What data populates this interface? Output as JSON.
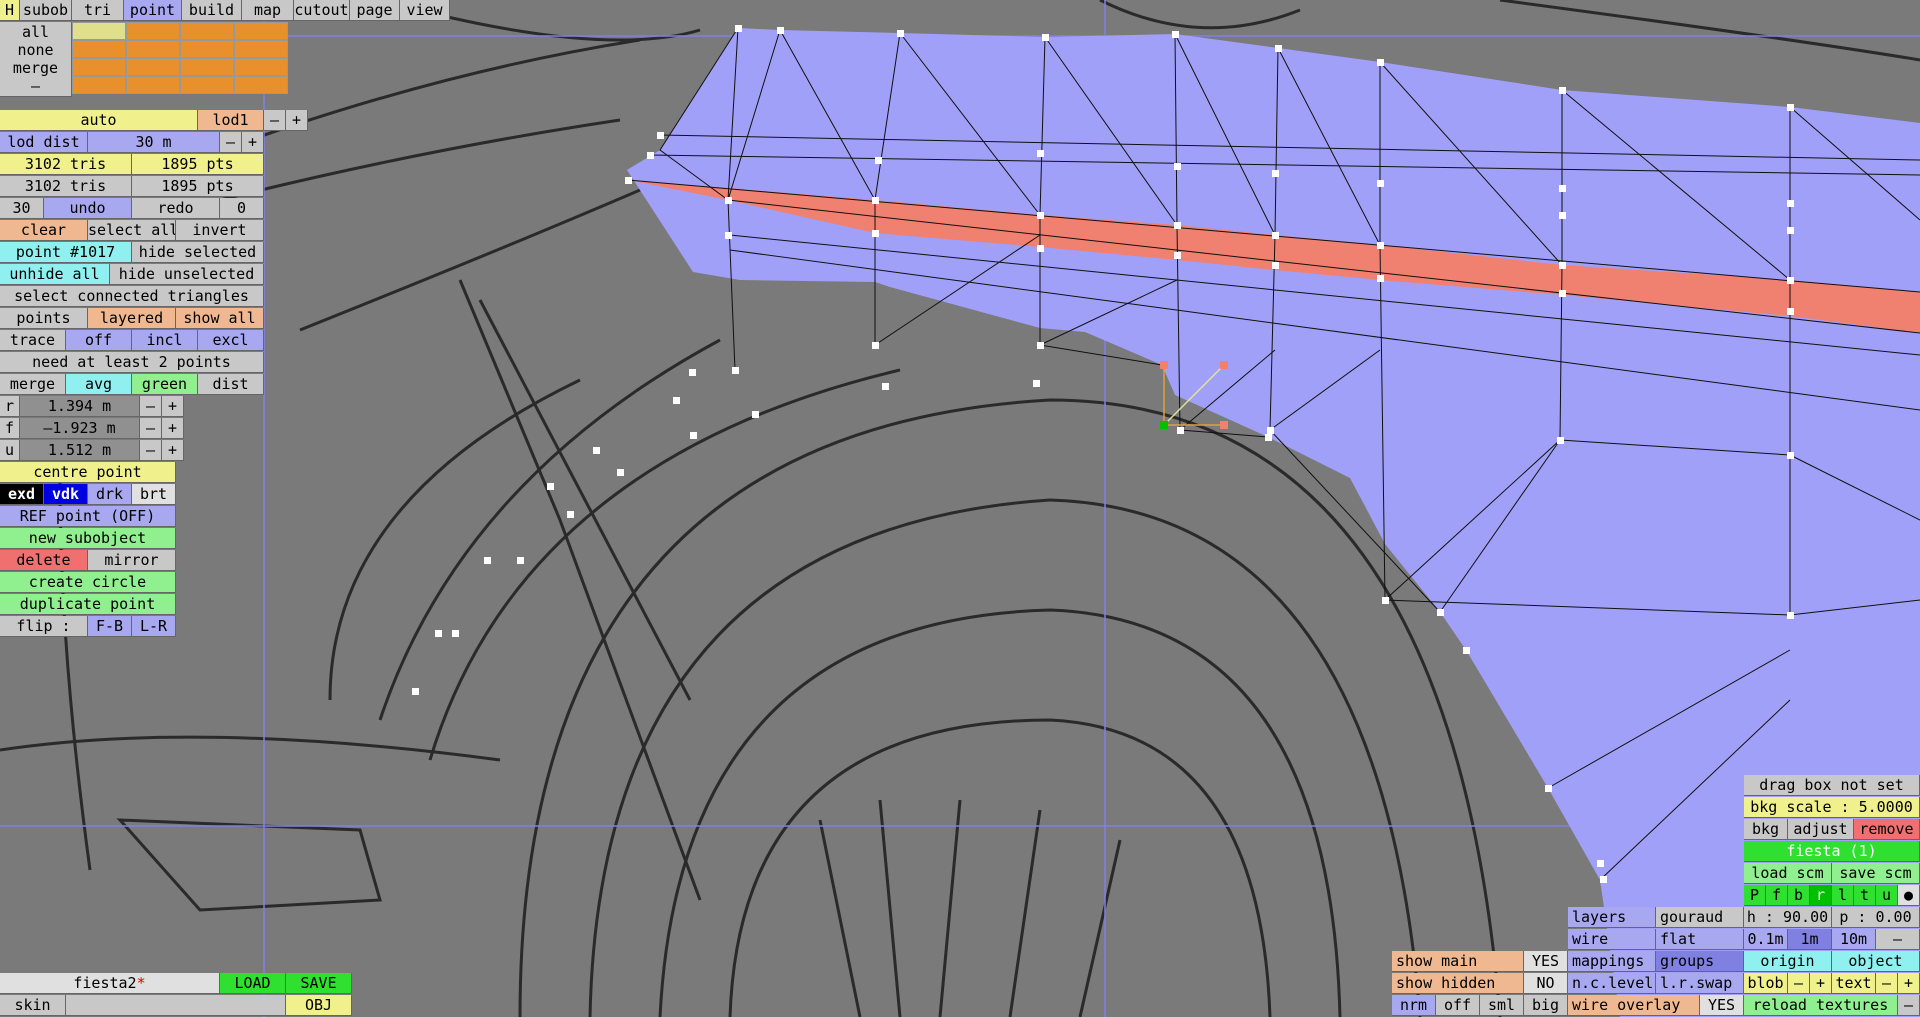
{
  "app": {
    "filename": "fiesta2",
    "modified_mark": "*"
  },
  "menu": {
    "h": "H",
    "tabs": [
      "subob",
      "tri",
      "point",
      "build",
      "map",
      "cutout",
      "page",
      "view"
    ],
    "active": "point"
  },
  "sel_rows": [
    "all",
    "none",
    "merge",
    "–"
  ],
  "lod": {
    "auto": "auto",
    "level": "lod1",
    "minus": "–",
    "plus": "+",
    "dist_label": "lod dist",
    "dist_value": "30 m"
  },
  "stats": {
    "tris1": "3102 tris",
    "pts1": "1895 pts",
    "tris2": "3102 tris",
    "pts2": "1895 pts"
  },
  "undo": {
    "count": "30",
    "undo": "undo",
    "redo": "redo",
    "redo_count": "0"
  },
  "select": {
    "clear": "clear",
    "select_all": "select all",
    "invert": "invert"
  },
  "point": {
    "id": "point #1017",
    "hide_selected": "hide selected",
    "unhide_all": "unhide all",
    "hide_unselected": "hide unselected",
    "connected": "select connected triangles"
  },
  "display": {
    "points": "points",
    "layered": "layered",
    "show_all": "show all"
  },
  "trace": {
    "label": "trace",
    "off": "off",
    "incl": "incl",
    "excl": "excl"
  },
  "need": "need at least 2 points",
  "merge": {
    "merge": "merge",
    "avg": "avg",
    "green": "green",
    "dist": "dist"
  },
  "coords": [
    {
      "axis": "r",
      "value": "1.394 m"
    },
    {
      "axis": "f",
      "value": "–1.923 m"
    },
    {
      "axis": "u",
      "value": "1.512 m"
    }
  ],
  "coord_minus": "–",
  "coord_plus": "+",
  "actions": {
    "centre": "centre point",
    "exd": "exd",
    "vdk": "vdk",
    "drk": "drk",
    "brt": "brt",
    "ref": "REF point (OFF)",
    "new_sub": "new subobject",
    "delete": "delete",
    "mirror": "mirror",
    "circle": "create circle",
    "duplicate": "duplicate point",
    "flip": "flip :",
    "fb": "F-B",
    "lr": "L-R"
  },
  "bottom_left": {
    "load": "LOAD",
    "save": "SAVE",
    "skin": "skin",
    "obj": "OBJ"
  },
  "bottom_mid": {
    "show_main": "show main",
    "show_main_val": "YES",
    "show_hidden": "show hidden",
    "show_hidden_val": "NO",
    "nrm": "nrm",
    "off": "off",
    "sml": "sml",
    "big": "big"
  },
  "render": {
    "layers": "layers",
    "gouraud": "gouraud",
    "wire": "wire",
    "flat": "flat",
    "mappings": "mappings",
    "groups": "groups",
    "nclevel": "n.c.level",
    "lrswap": "l.r.swap",
    "wire_overlay": "wire overlay",
    "wire_overlay_val": "YES"
  },
  "right_panel": {
    "drag": "drag box not set",
    "bkg_scale": "bkg scale : 5.0000",
    "bkg": "bkg",
    "adjust": "adjust",
    "remove": "remove",
    "model": "fiesta (1)",
    "load_scm": "load scm",
    "save_scm": "save scm",
    "views": [
      "P",
      "f",
      "b",
      "r",
      "l",
      "t",
      "u",
      "●"
    ],
    "h": "h : 90.00",
    "p": "p : 0.00",
    "steps": [
      "0.1m",
      "1m",
      "10m",
      "–"
    ],
    "origin": "origin",
    "object": "object",
    "blob": "blob",
    "text": "text",
    "reload": "reload textures"
  },
  "colors": {
    "mesh": "#a0a0f8",
    "stripe": "#f08070",
    "selected": "#00c000"
  }
}
